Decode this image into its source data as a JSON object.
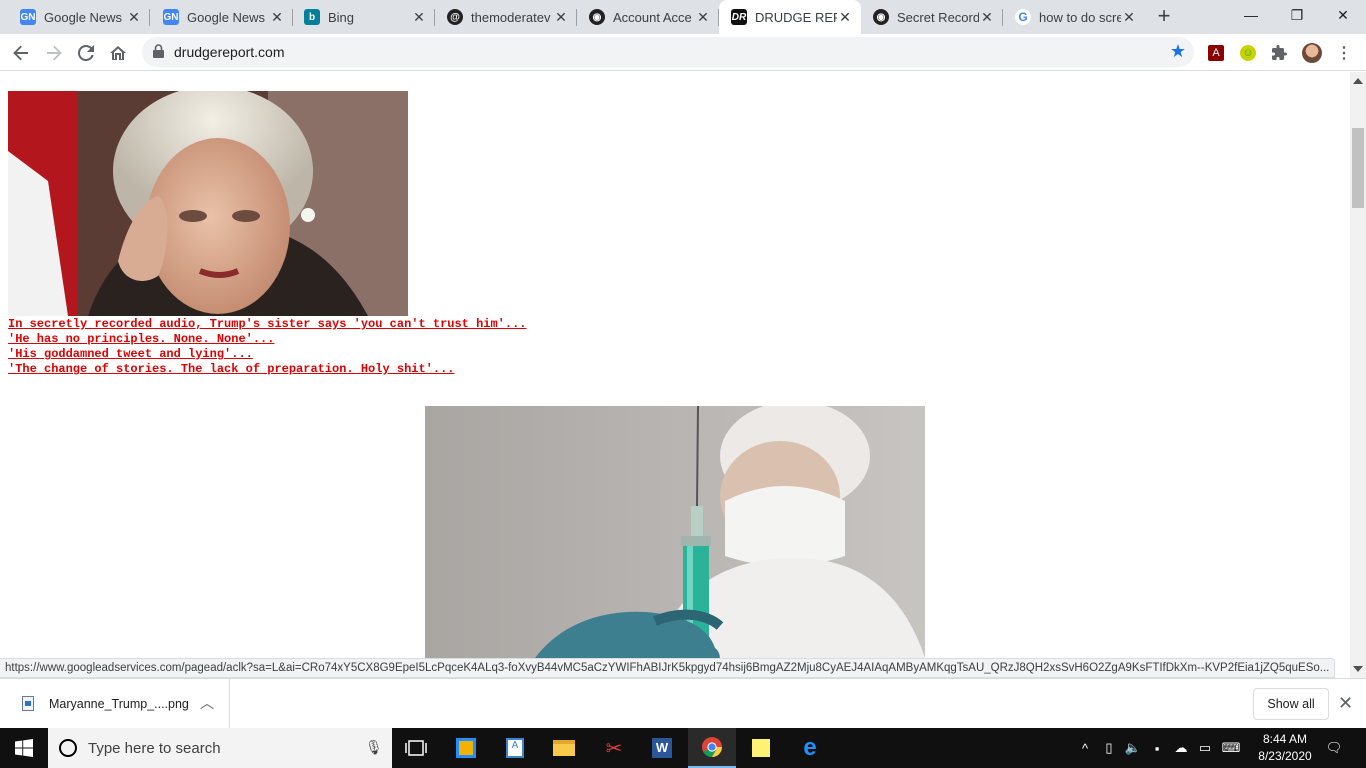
{
  "browser": {
    "tabs": [
      {
        "title": "Google News",
        "icon": "google-news-icon",
        "active": false
      },
      {
        "title": "Google News",
        "icon": "google-news-icon",
        "active": false
      },
      {
        "title": "Bing",
        "icon": "bing-icon",
        "active": false
      },
      {
        "title": "themoderatev",
        "icon": "at-sign-icon",
        "active": false
      },
      {
        "title": "Account Acce",
        "icon": "eye-icon",
        "active": false
      },
      {
        "title": "DRUDGE REPO",
        "icon": "drudge-icon",
        "active": true
      },
      {
        "title": "Secret Record",
        "icon": "eye-icon",
        "active": false
      },
      {
        "title": "how to do scre",
        "icon": "google-icon",
        "active": false
      }
    ],
    "url": "drudgereport.com",
    "status_url": "https://www.googleadservices.com/pagead/aclk?sa=L&ai=CRo74xY5CX8G9EpeI5LcPqceK4ALq3-foXvyB44vMC5aCzYWIFhABIJrK5kpgyd74hsij6BmgAZ2Mju8CyAEJ4AIAqAMByAMKqgTsAU_QRzJ8QH2xsSvH6O2ZgA9KsFTIfDkXm--KVP2fEia1jZQ5quESo..."
  },
  "page": {
    "headlines": [
      "In secretly recorded audio, Trump's sister says 'you can't trust him'...",
      "'He has no principles. None. None'...",
      "'His goddamned tweet and lying'...",
      "'The change of stories. The lack of preparation. Holy shit'..."
    ],
    "headline_color": "#e00000"
  },
  "downloads": {
    "file_name": "Maryanne_Trump_....png",
    "show_all_label": "Show all"
  },
  "taskbar": {
    "search_placeholder": "Type here to search",
    "time": "8:44 AM",
    "date": "8/23/2020"
  }
}
